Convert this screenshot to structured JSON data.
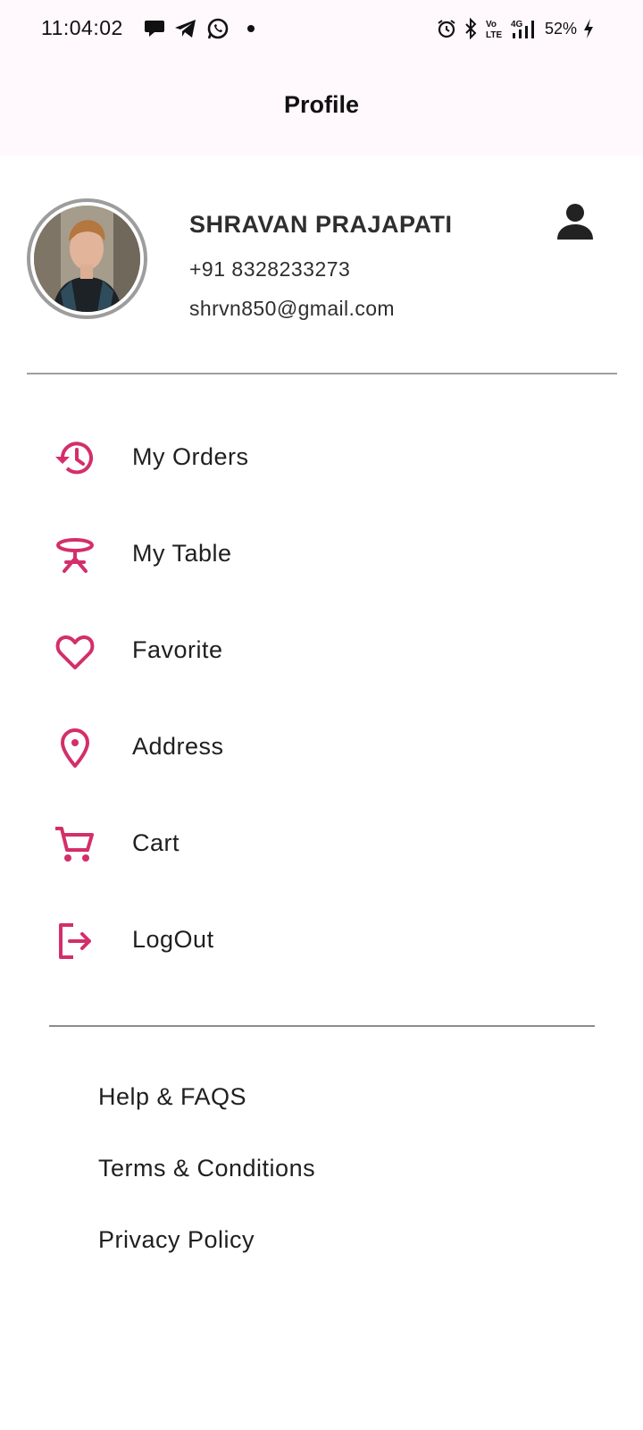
{
  "status_bar": {
    "time": "11:04:02",
    "battery": "52%",
    "network": "4G",
    "volte": "Vo LTE",
    "notification_icons": [
      "chat-icon",
      "telegram-icon",
      "whatsapp-icon",
      "dot-icon"
    ],
    "system_icons": [
      "alarm-icon",
      "bluetooth-icon",
      "volte-icon",
      "signal-icon",
      "battery-charging-icon"
    ]
  },
  "app_bar": {
    "title": "Profile"
  },
  "profile": {
    "name": "SHRAVAN PRAJAPATI",
    "phone": "+91 8328233273",
    "email": "shrvn850@gmail.com",
    "avatar_icon": "avatar-photo",
    "action_icon": "person-icon"
  },
  "menu": {
    "accent_color": "#d32f6a",
    "items": [
      {
        "label": "My Orders",
        "icon": "history-icon"
      },
      {
        "label": "My Table",
        "icon": "table-icon"
      },
      {
        "label": "Favorite",
        "icon": "heart-icon"
      },
      {
        "label": "Address",
        "icon": "location-pin-icon"
      },
      {
        "label": "Cart",
        "icon": "cart-icon"
      },
      {
        "label": "LogOut",
        "icon": "logout-icon"
      }
    ]
  },
  "links": [
    {
      "label": "Help & FAQS"
    },
    {
      "label": "Terms & Conditions"
    },
    {
      "label": "Privacy Policy"
    }
  ],
  "colors": {
    "header_bg": "#fff8fd",
    "accent": "#d32f6a",
    "text": "#1f1f1f",
    "divider": "#9e9e9e"
  }
}
